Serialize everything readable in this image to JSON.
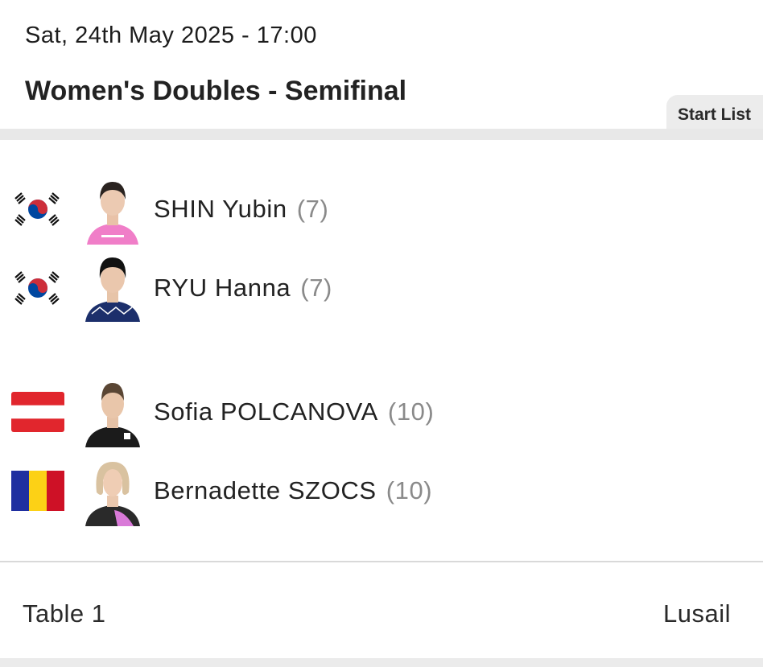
{
  "match": {
    "datetime": "Sat, 24th May 2025 - 17:00",
    "title": "Women's Doubles - Semifinal",
    "tab_label": "Start List"
  },
  "teams": [
    {
      "players": [
        {
          "name": "SHIN Yubin",
          "seed": "(7)",
          "flag": "korea-flag-icon"
        },
        {
          "name": "RYU Hanna",
          "seed": "(7)",
          "flag": "korea-flag-icon"
        }
      ]
    },
    {
      "players": [
        {
          "name": "Sofia POLCANOVA",
          "seed": "(10)",
          "flag": "austria-flag-icon"
        },
        {
          "name": "Bernadette SZOCS",
          "seed": "(10)",
          "flag": "romania-flag-icon"
        }
      ]
    }
  ],
  "footer": {
    "table": "Table 1",
    "venue": "Lusail"
  },
  "colors": {
    "korea_red": "#cd2e3a",
    "korea_blue": "#0047a0",
    "austria_red": "#e1262d",
    "romania_blue": "#1f2fa0",
    "romania_yellow": "#fcd116",
    "romania_red": "#ce1126"
  }
}
